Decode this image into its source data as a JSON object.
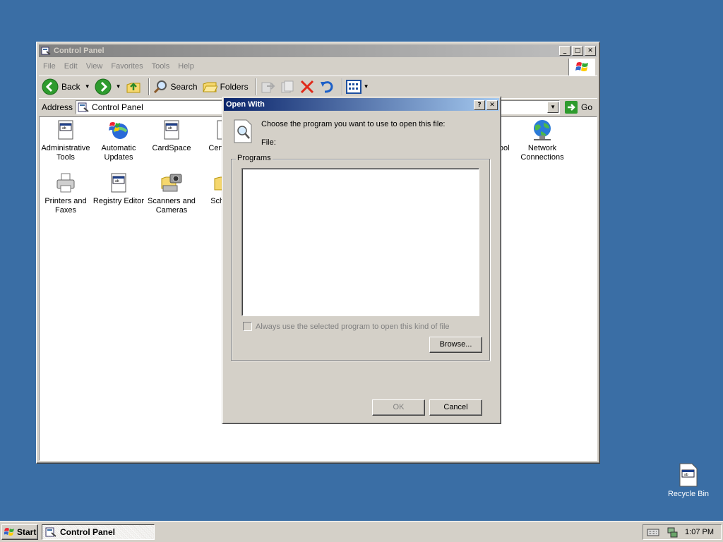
{
  "control_panel": {
    "title": "Control Panel",
    "menu": [
      "File",
      "Edit",
      "View",
      "Favorites",
      "Tools",
      "Help"
    ],
    "toolbar": {
      "back_label": "Back",
      "search_label": "Search",
      "folders_label": "Folders"
    },
    "address": {
      "label": "Address",
      "value": "Control Panel",
      "go_label": "Go"
    },
    "items": {
      "admin_tools": "Administrative Tools",
      "auto_updates": "Automatic Updates",
      "cardspace": "CardSpace",
      "cert_partial": "Cert Man",
      "printers": "Printers and Faxes",
      "registry": "Registry Editor",
      "scanners": "Scanners and Cameras",
      "sched_partial": "Sche Ta",
      "hidden_partial": "s ool",
      "network": "Network Connections"
    }
  },
  "dialog": {
    "title": "Open With",
    "help_btn": "?",
    "instruction": "Choose the program you want to use to open this file:",
    "file_label": "File:",
    "group_label": "Programs",
    "checkbox_label": "Always use the selected program to open this kind of file",
    "browse_label": "Browse...",
    "ok_label": "OK",
    "cancel_label": "Cancel"
  },
  "desktop": {
    "recycle_bin": "Recycle Bin"
  },
  "taskbar": {
    "start_label": "Start",
    "task_label": "Control Panel",
    "clock": "1:07 PM"
  }
}
